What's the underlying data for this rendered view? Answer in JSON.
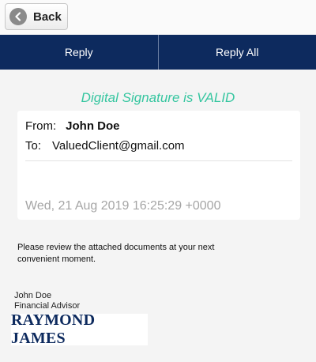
{
  "header": {
    "back_label": "Back"
  },
  "actions": {
    "reply_label": "Reply",
    "reply_all_label": "Reply All"
  },
  "signature_status": "Digital Signature is VALID",
  "email": {
    "from_label": "From:",
    "from_name": "John Doe",
    "to_label": "To:",
    "to_address": "ValuedClient@gmail.com",
    "date": "Wed, 21 Aug 2019 16:25:29 +0000",
    "body": "Please review the attached documents at your next convenient moment.",
    "signature_name": "John Doe",
    "signature_title": "Financial Advisor",
    "logo_text": "RAYMOND JAMES"
  },
  "colors": {
    "navy": "#0d2a5e",
    "valid_green": "#36c6a0",
    "date_gray": "#a5a5a5"
  }
}
